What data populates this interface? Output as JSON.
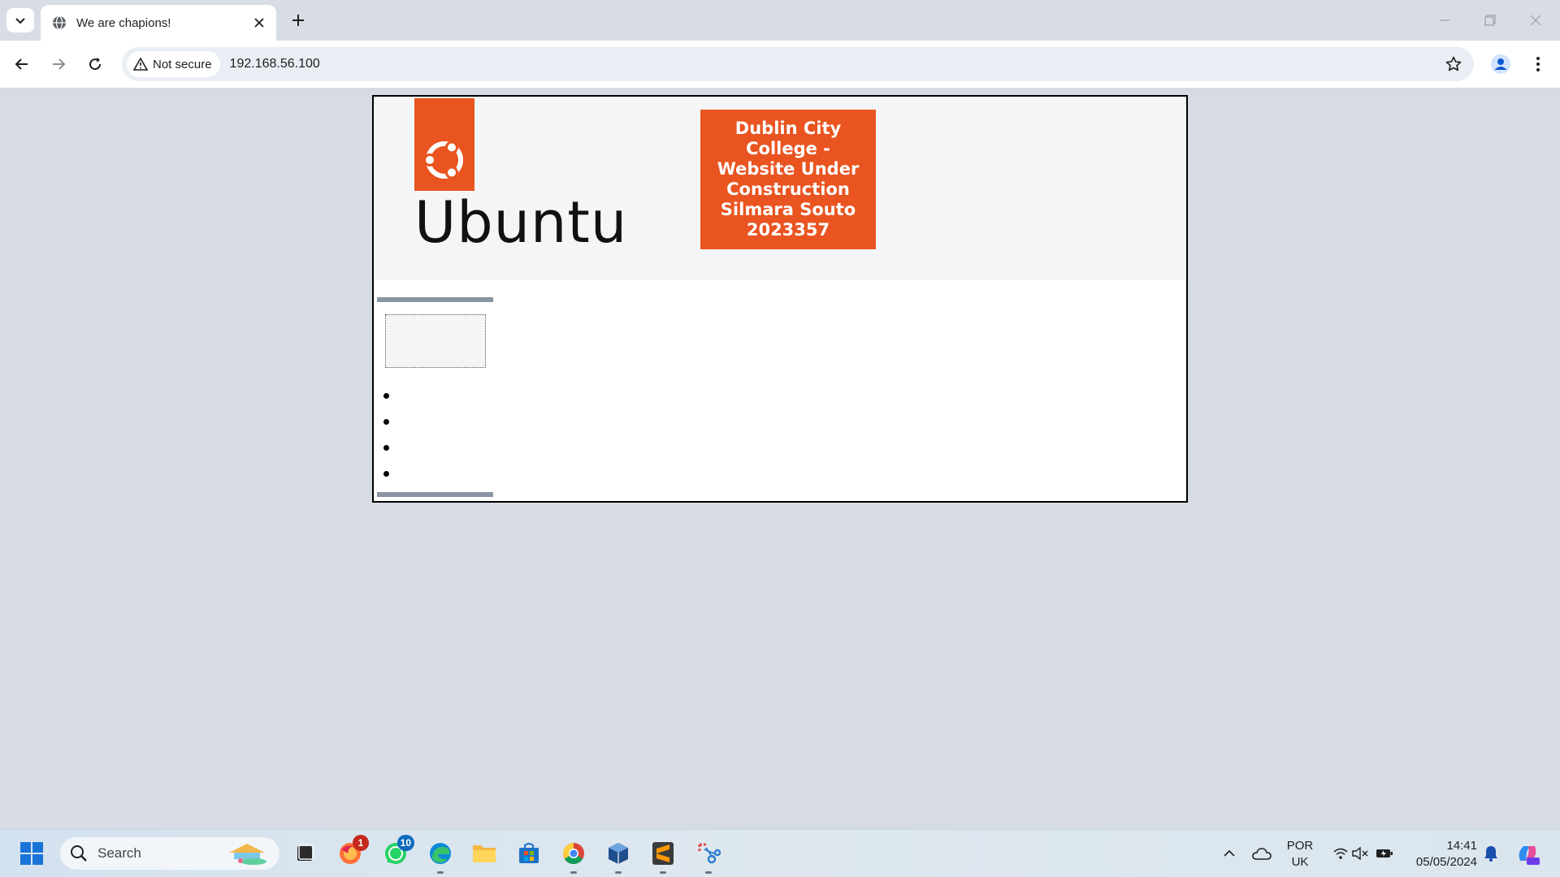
{
  "browser": {
    "tab": {
      "title": "We are chapions!"
    },
    "address_bar": {
      "security_label": "Not secure",
      "url": "192.168.56.100"
    }
  },
  "page": {
    "logo_text": "Ubuntu",
    "banner_lines": [
      "Dublin City",
      "College -",
      "Website Under",
      "Construction",
      "Silmara Souto",
      "2023357"
    ],
    "list_items": [
      "",
      "",
      "",
      ""
    ]
  },
  "taskbar": {
    "search_placeholder": "Search",
    "apps": [
      {
        "name": "task-view",
        "badge": ""
      },
      {
        "name": "firefox",
        "badge": "1"
      },
      {
        "name": "whatsapp",
        "badge": "10"
      },
      {
        "name": "edge",
        "badge": ""
      },
      {
        "name": "file-explorer",
        "badge": ""
      },
      {
        "name": "microsoft-store",
        "badge": ""
      },
      {
        "name": "chrome",
        "badge": ""
      },
      {
        "name": "virtualbox",
        "badge": ""
      },
      {
        "name": "sublime-text",
        "badge": ""
      },
      {
        "name": "snipping-tool",
        "badge": ""
      }
    ],
    "language": {
      "line1": "POR",
      "line2": "UK"
    },
    "clock": {
      "time": "14:41",
      "date": "05/05/2024"
    }
  },
  "colors": {
    "ubuntu_orange": "#e95420",
    "page_header_bg": "#f4f5f7",
    "browser_frame": "#d7dbe3"
  }
}
